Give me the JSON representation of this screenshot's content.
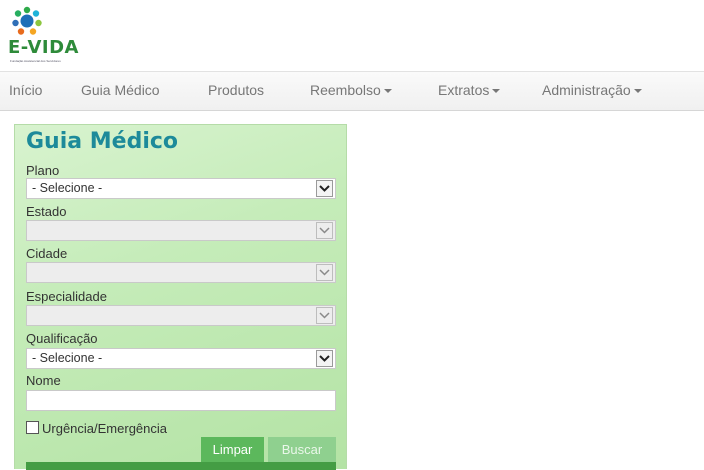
{
  "logo": {
    "text": "E-VIDA",
    "tagline": "Fundação Assistencial dos Servidores"
  },
  "nav": {
    "items": [
      {
        "label": "Início",
        "dropdown": false
      },
      {
        "label": "Guia Médico",
        "dropdown": false
      },
      {
        "label": "Produtos",
        "dropdown": false
      },
      {
        "label": "Reembolso",
        "dropdown": true
      },
      {
        "label": "Extratos",
        "dropdown": true
      },
      {
        "label": "Administração",
        "dropdown": true
      }
    ]
  },
  "form": {
    "title": "Guia Médico",
    "plano": {
      "label": "Plano",
      "value": "- Selecione -"
    },
    "estado": {
      "label": "Estado",
      "value": ""
    },
    "cidade": {
      "label": "Cidade",
      "value": ""
    },
    "especialidade": {
      "label": "Especialidade",
      "value": ""
    },
    "qualificacao": {
      "label": "Qualificação",
      "value": "- Selecione -"
    },
    "nome": {
      "label": "Nome",
      "value": ""
    },
    "urgencia": {
      "label": "Urgência/Emergência",
      "checked": false
    },
    "clear_label": "Limpar",
    "search_label": "Buscar"
  },
  "colors": {
    "title": "#1d8a9a",
    "logo": "#2e8b3a",
    "button_primary": "#5cb85c",
    "button_disabled": "#8fd08f"
  }
}
